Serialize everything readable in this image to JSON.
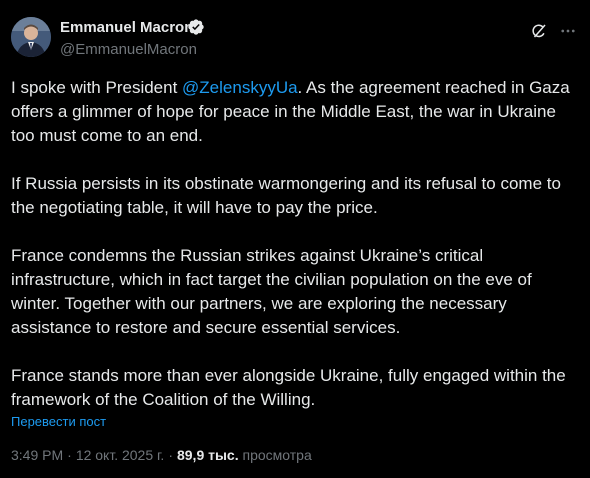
{
  "author": {
    "name": "Emmanuel Macron",
    "handle": "@EmmanuelMacron"
  },
  "tweet": {
    "p1_before": "I spoke with President ",
    "p1_mention": "@ZelenskyyUa",
    "p1_after": ". As the agreement reached in Gaza offers a glimmer of hope for peace in the Middle East, the war in Ukraine too must come to an end.",
    "p2": "If Russia persists in its obstinate warmongering and its refusal to come to the negotiating table, it will have to pay the price.",
    "p3": "France condemns the Russian strikes against Ukraine’s critical infrastructure, which in fact target the civilian population on the eve of winter. Together with our partners, we are exploring the necessary assistance to restore and secure essential services.",
    "p4": "France stands more than ever alongside Ukraine, fully engaged within the framework of the Coalition of the Willing."
  },
  "translate_label": "Перевести пост",
  "meta": {
    "time": "3:49 PM",
    "separator": "·",
    "date": "12 окт. 2025 г.",
    "views_count": "89,9 тыс.",
    "views_label": "просмотра"
  },
  "colors": {
    "background": "#000000",
    "text": "#e7e9ea",
    "secondary": "#71767b",
    "accent": "#1d9bf0"
  },
  "icons": [
    "avatar-photo",
    "verified-badge-icon",
    "grok-icon",
    "more-options-icon"
  ]
}
